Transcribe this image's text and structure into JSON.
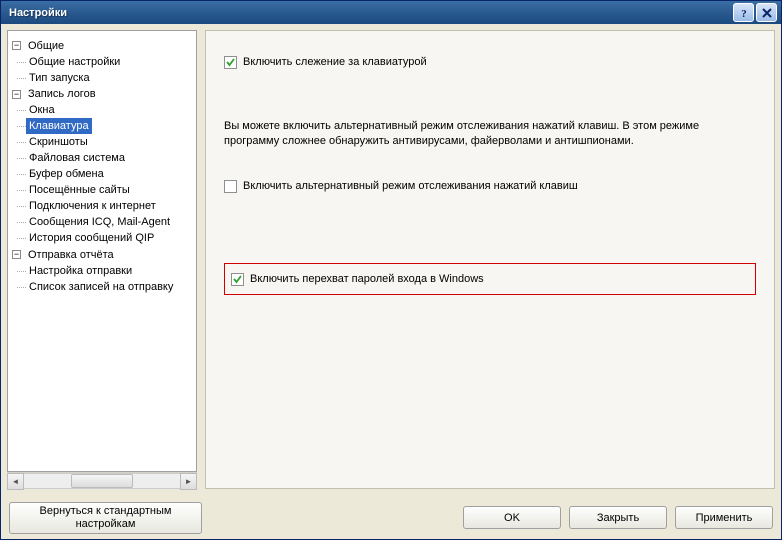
{
  "window": {
    "title": "Настройки"
  },
  "tree": {
    "general": {
      "label": "Общие",
      "children": {
        "general_settings": "Общие настройки",
        "startup_type": "Тип запуска"
      }
    },
    "logging": {
      "label": "Запись логов",
      "children": {
        "windows": "Окна",
        "keyboard": "Клавиатура",
        "screenshots": "Скриншоты",
        "filesystem": "Файловая система",
        "clipboard": "Буфер обмена",
        "visited_sites": "Посещённые сайты",
        "inet_conn": "Подключения к интернет",
        "icq_mail": "Сообщения ICQ, Mail-Agent",
        "qip_history": "История сообщений QIP"
      }
    },
    "report": {
      "label": "Отправка отчёта",
      "children": {
        "send_settings": "Настройка отправки",
        "send_list": "Список записей на отправку"
      }
    }
  },
  "content": {
    "enable_tracking": {
      "label": "Включить слежение за клавиатурой",
      "checked": true
    },
    "description": "Вы можете включить альтернативный режим отслеживания нажатий клавиш. В этом режиме программу сложнее обнаружить антивирусами, файерволами и антишпионами.",
    "enable_alt_mode": {
      "label": "Включить альтернативный режим отслеживания нажатий клавиш",
      "checked": false
    },
    "enable_win_pwd": {
      "label": "Включить перехват паролей входа в Windows",
      "checked": true
    }
  },
  "footer": {
    "revert": "Вернуться к стандартным настройкам",
    "ok": "OK",
    "close": "Закрыть",
    "apply": "Применить"
  }
}
